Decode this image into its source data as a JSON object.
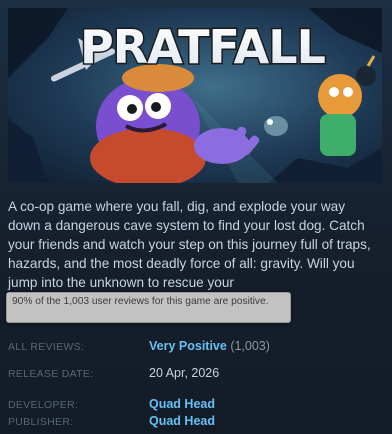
{
  "header_image": {
    "logo_text": "PRATFALL"
  },
  "description": "A co-op game where you fall, dig, and explode your way down a dangerous cave system to find your lost dog. Catch your friends and watch your step on this journey full of traps, hazards, and the most deadly force of all: gravity. Will you jump into the unknown to rescue your",
  "tooltip": "90% of the 1,003 user reviews for this game are positive.",
  "details": {
    "all_reviews_label": "ALL REVIEWS:",
    "all_reviews_value": "Very Positive",
    "all_reviews_count": "(1,003)",
    "release_date_label": "RELEASE DATE:",
    "release_date_value": "20 Apr, 2026",
    "developer_label": "DEVELOPER:",
    "developer_value": "Quad Head",
    "publisher_label": "PUBLISHER:",
    "publisher_value": "Quad Head"
  },
  "colors": {
    "link": "#66c0f4",
    "text": "#c6d4df",
    "label": "#556772",
    "tooltip_bg": "#c2c2c2"
  }
}
